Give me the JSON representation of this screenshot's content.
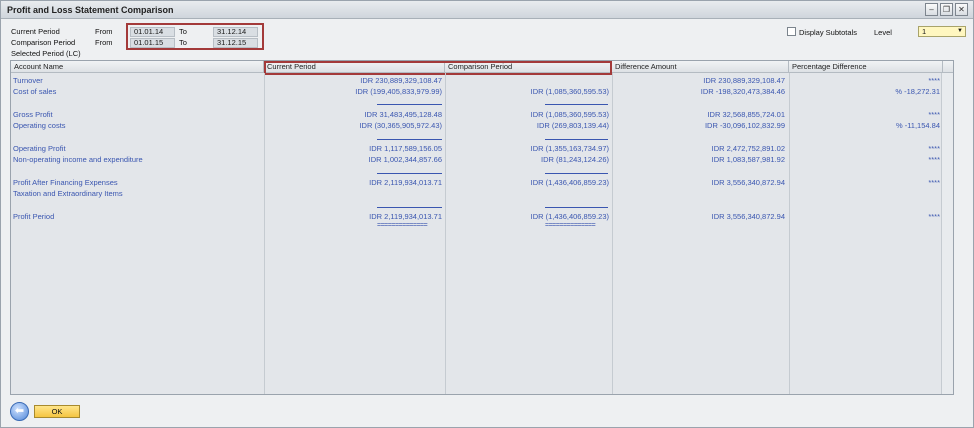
{
  "window": {
    "title": "Profit and Loss Statement Comparison",
    "minimize": "–",
    "restore": "❐",
    "close": "✕"
  },
  "periods": {
    "current_label": "Current Period",
    "comparison_label": "Comparison Period",
    "from_label": "From",
    "to_label": "To",
    "current_from": "01.01.14",
    "current_to": "31.12.14",
    "comparison_from": "01.01.15",
    "comparison_to": "31.12.15",
    "selected_period": "Selected Period (LC)"
  },
  "options": {
    "display_subtotals": "Display Subtotals",
    "level_label": "Level",
    "level_value": "1"
  },
  "grid": {
    "headers": [
      "Account Name",
      "Current Period",
      "Comparison Period",
      "Difference Amount",
      "Percentage Difference"
    ],
    "rows": [
      {
        "name": "Turnover",
        "current": "IDR  230,889,329,108.47",
        "comparison": "",
        "difference": "IDR 230,889,329,108.47",
        "percent": "****"
      },
      {
        "name": "Cost of sales",
        "current": "IDR (199,405,833,979.99)",
        "comparison": "IDR (1,085,360,595.53)",
        "difference": "IDR -198,320,473,384.46",
        "percent": "% -18,272.31"
      },
      {
        "name": "Gross Profit",
        "current": "IDR  31,483,495,128.48",
        "comparison": "IDR (1,085,360,595.53)",
        "difference": "IDR 32,568,855,724.01",
        "percent": "****"
      },
      {
        "name": "Operating costs",
        "current": "IDR (30,365,905,972.43)",
        "comparison": "IDR (269,803,139.44)",
        "difference": "IDR -30,096,102,832.99",
        "percent": "% -11,154.84"
      },
      {
        "name": "Operating Profit",
        "current": "IDR  1,117,589,156.05",
        "comparison": "IDR (1,355,163,734.97)",
        "difference": "IDR 2,472,752,891.02",
        "percent": "****"
      },
      {
        "name": "Non-operating income and expenditure",
        "current": "IDR  1,002,344,857.66",
        "comparison": "IDR (81,243,124.26)",
        "difference": "IDR 1,083,587,981.92",
        "percent": "****"
      },
      {
        "name": "Profit After Financing Expenses",
        "current": "IDR  2,119,934,013.71",
        "comparison": "IDR (1,436,406,859.23)",
        "difference": "IDR 3,556,340,872.94",
        "percent": "****"
      },
      {
        "name": "Taxation and Extraordinary Items",
        "current": "",
        "comparison": "",
        "difference": "",
        "percent": ""
      },
      {
        "name": "Profit Period",
        "current": "IDR  2,119,934,013.71",
        "comparison": "IDR (1,436,406,859.23)",
        "difference": "IDR 3,556,340,872.94",
        "percent": "****"
      }
    ],
    "double_underline": "=============="
  },
  "buttons": {
    "ok": "OK",
    "back_icon": "back-arrow-icon"
  }
}
